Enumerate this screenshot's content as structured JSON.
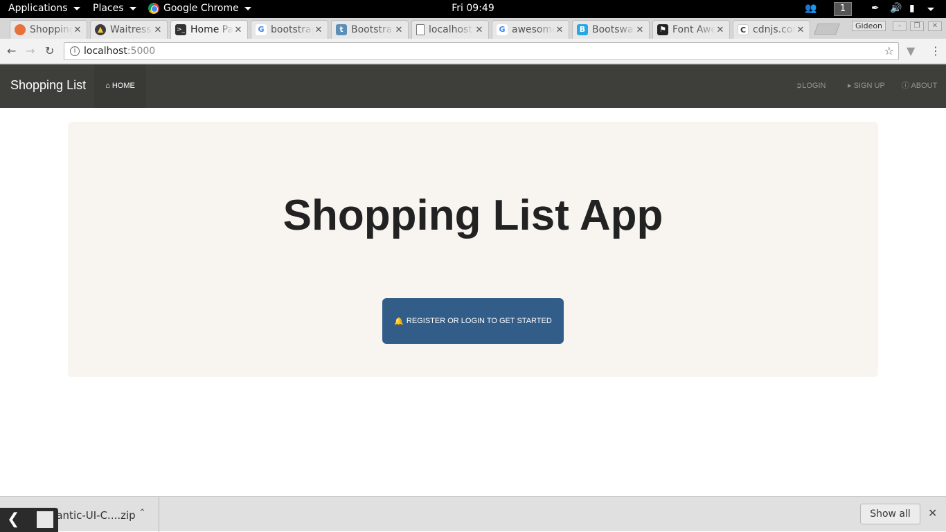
{
  "topbar": {
    "applications": "Applications",
    "places": "Places",
    "browser": "Google Chrome",
    "clock": "Fri 09:49",
    "workspace": "1"
  },
  "tabs": [
    {
      "title": "Shopping",
      "favicon": "shopping-favicon",
      "fav_color": "#e8703a",
      "active": false
    },
    {
      "title": "Waitress",
      "favicon": "waitress-favicon",
      "fav_color": "#3b3b3b",
      "active": false
    },
    {
      "title": "Home Page",
      "favicon": "terminal-favicon",
      "fav_color": "#333333",
      "active": true
    },
    {
      "title": "bootstrap",
      "favicon": "google-favicon",
      "fav_color": "#4285f4",
      "active": false
    },
    {
      "title": "Bootstrap",
      "favicon": "bootstrap-favicon",
      "fav_color": "#5b8fb9",
      "active": false
    },
    {
      "title": "localhost",
      "favicon": "page-favicon",
      "fav_color": "#999999",
      "active": false
    },
    {
      "title": "awesome",
      "favicon": "google-favicon",
      "fav_color": "#4285f4",
      "active": false
    },
    {
      "title": "Bootswatch",
      "favicon": "bootswatch-favicon",
      "fav_color": "#2aa7e0",
      "active": false
    },
    {
      "title": "Font Awesome",
      "favicon": "flag-favicon",
      "fav_color": "#222222",
      "active": false
    },
    {
      "title": "cdnjs.com",
      "favicon": "cdnjs-favicon",
      "fav_color": "#ffffff",
      "active": false
    }
  ],
  "profile": "Gideon",
  "address": {
    "host": "localhost",
    "port": ":5000"
  },
  "navbar": {
    "brand": "Shopping List",
    "home": "HOME",
    "login": "LOGIN",
    "signup": "SIGN UP",
    "about": "ABOUT"
  },
  "jumbotron": {
    "headline": "Shopping List App",
    "cta": "REGISTER OR LOGIN TO GET STARTED"
  },
  "download": {
    "filename": "Semantic-UI-C....zip",
    "show_all": "Show all"
  },
  "colors": {
    "navbar_bg": "#3e3f3a",
    "jumbotron_bg": "#f8f5f0",
    "primary_button": "#325d88"
  }
}
